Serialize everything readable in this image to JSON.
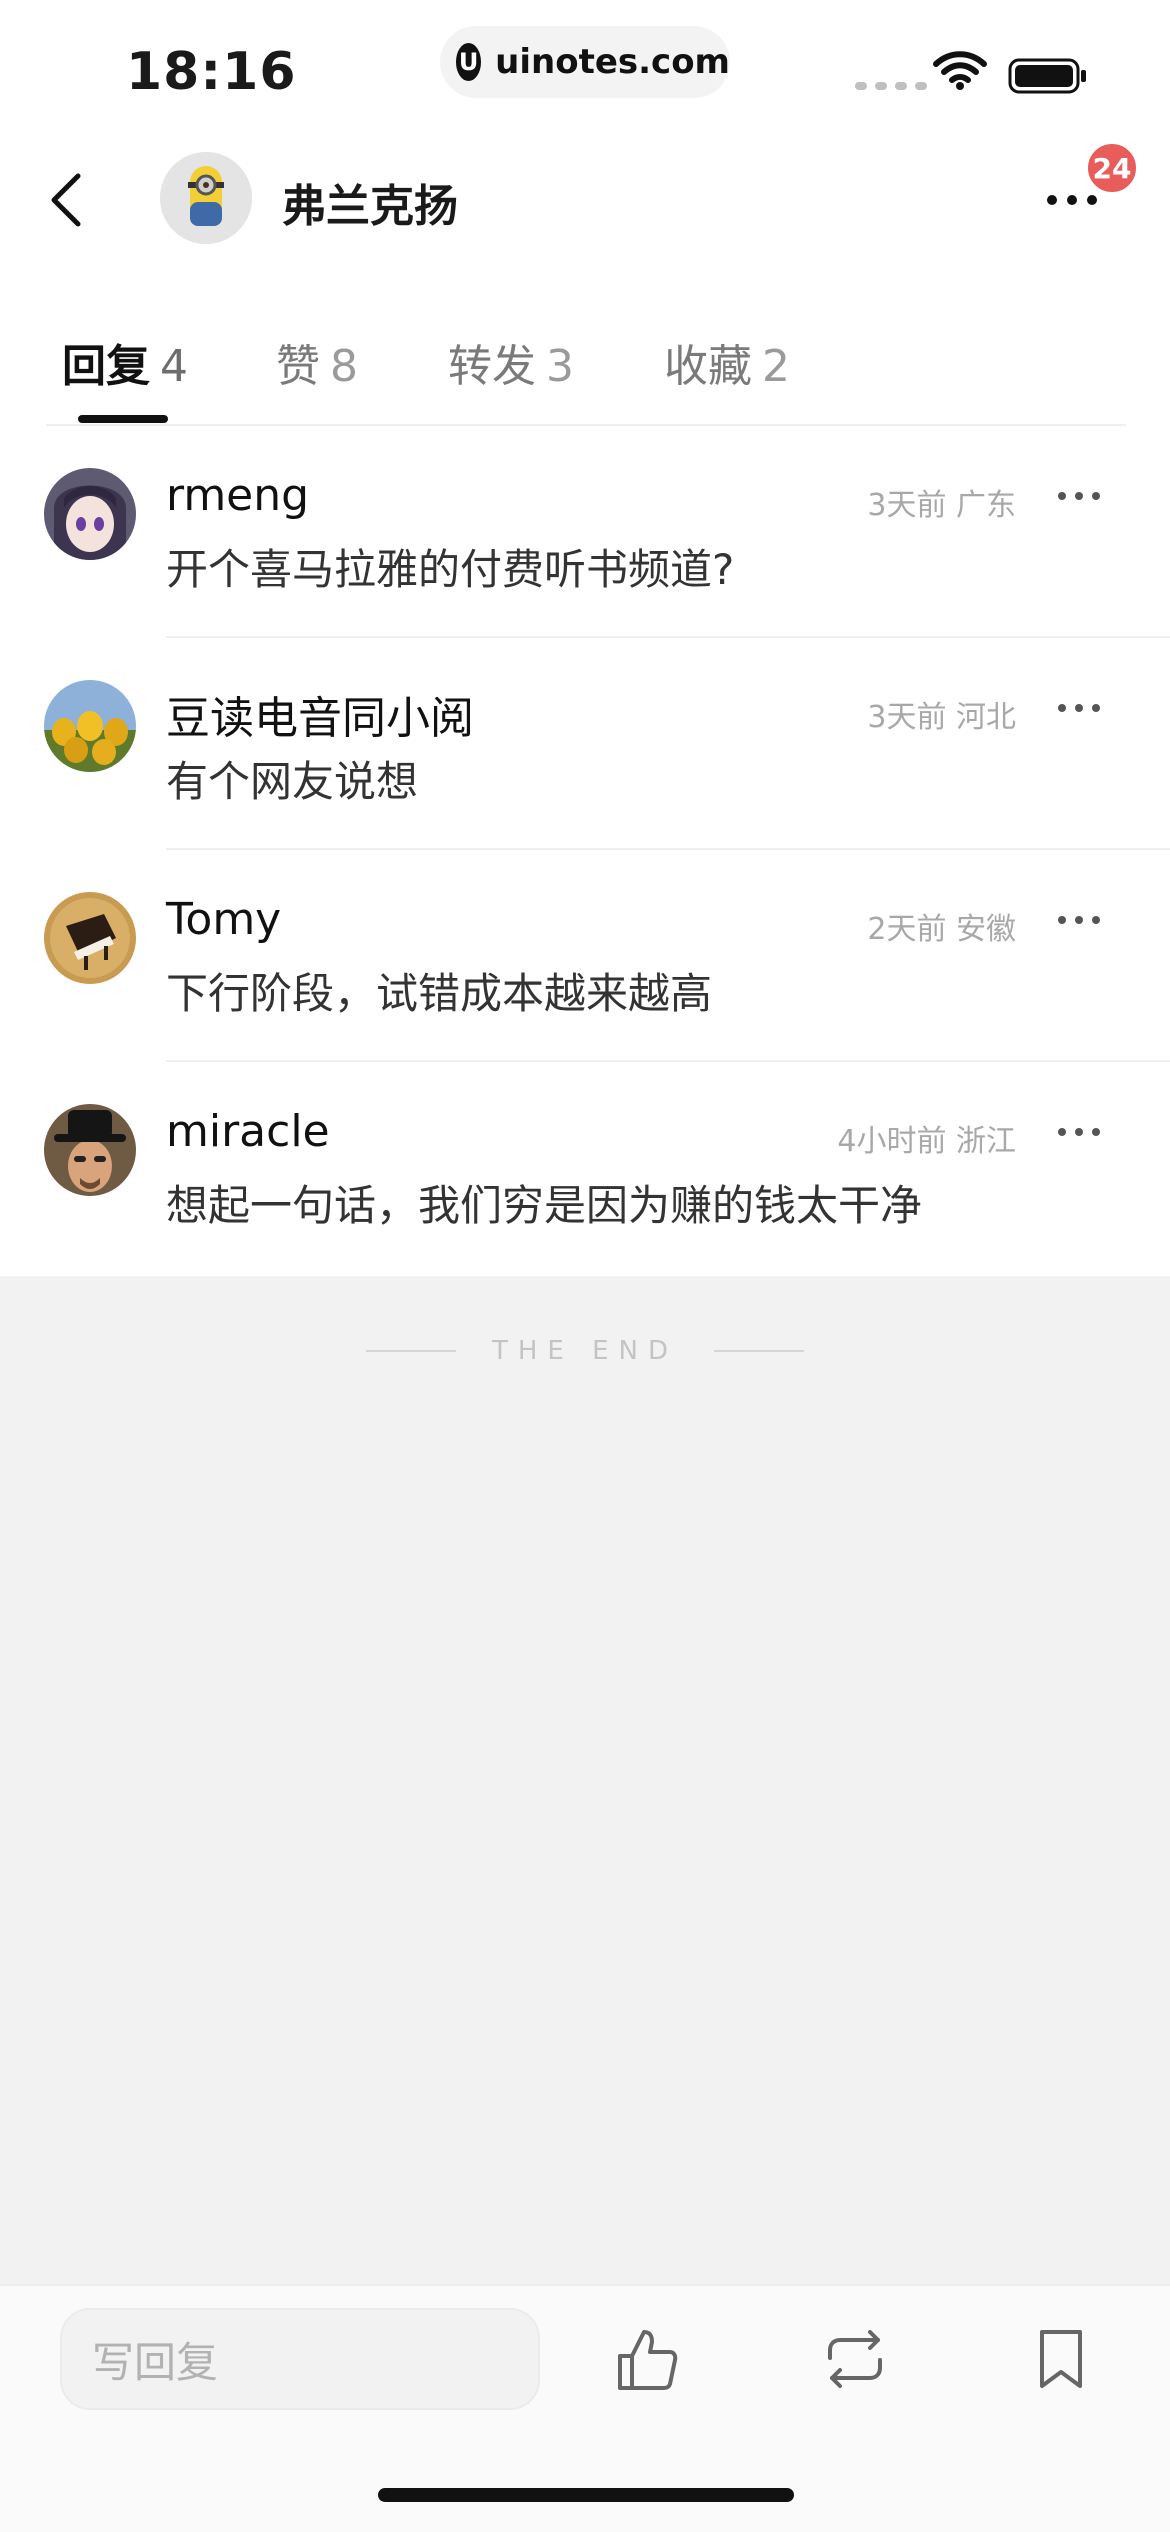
{
  "status_bar": {
    "time": "18:16",
    "url": "uinotes.com"
  },
  "nav": {
    "title": "弗兰克扬",
    "badge_count": "24"
  },
  "tabs": [
    {
      "label": "回复",
      "count": "4",
      "active": true
    },
    {
      "label": "赞",
      "count": "8",
      "active": false
    },
    {
      "label": "转发",
      "count": "3",
      "active": false
    },
    {
      "label": "收藏",
      "count": "2",
      "active": false
    }
  ],
  "replies": [
    {
      "name": "rmeng",
      "meta": "3天前 广东",
      "text": "开个喜马拉雅的付费听书频道?"
    },
    {
      "name": "豆读电音同小阅",
      "meta": "3天前 河北",
      "text": "有个网友说想"
    },
    {
      "name": "Tomy",
      "meta": "2天前 安徽",
      "text": "下行阶段，试错成本越来越高"
    },
    {
      "name": "miracle",
      "meta": "4小时前 浙江",
      "text": "想起一句话，我们穷是因为赚的钱太干净"
    }
  ],
  "end_marker": "THE END",
  "bottom_bar": {
    "reply_placeholder": "写回复"
  },
  "colors": {
    "badge": "#e85d5a",
    "background_gray": "#f2f2f2",
    "text_primary": "#111111",
    "text_meta": "#a8a8a8"
  }
}
